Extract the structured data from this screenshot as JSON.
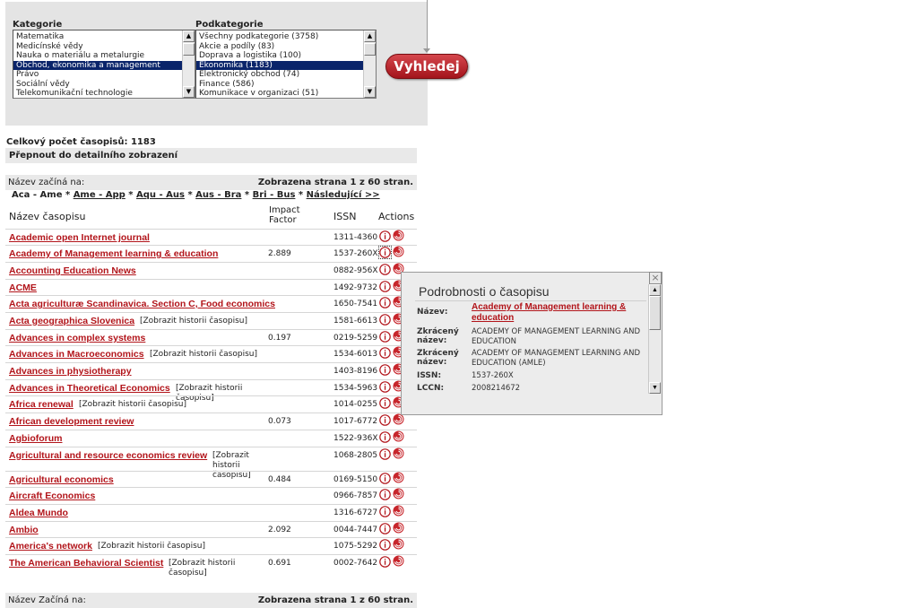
{
  "filters": {
    "category_label": "Kategorie",
    "category_options": [
      "Matematika",
      "Medicínské vědy",
      "Nauka o materiálu a metalurgie",
      "Obchod, ekonomika a management",
      "Právo",
      "Sociální vědy",
      "Telekomunikační technologie"
    ],
    "category_selected_index": 3,
    "subcategory_label": "Podkategorie",
    "subcategory_options": [
      "Všechny podkategorie (3758)",
      "Akcie a podíly (83)",
      "Doprava a logistika (100)",
      "Ekonomika (1183)",
      "Elektronický obchod (74)",
      "Finance (586)",
      "Komunikace v organizaci (51)"
    ],
    "subcategory_selected_index": 3,
    "search_label": "Vyhledej"
  },
  "summary": {
    "total_count": "Celkový počet časopisů: 1183",
    "toggle_view": "Přepnout do detailního zobrazení",
    "starts_with_label": "Název začíná na:",
    "starts_with_label_bottom": "Název Začíná na:",
    "page_info": "Zobrazena strana 1 z 60 stran."
  },
  "alpha_nav": {
    "current": "Aca - Ame",
    "links": [
      "Ame - App",
      "Aqu - Aus",
      "Aus - Bra",
      "Bri - Bus"
    ],
    "next": "Následující >>"
  },
  "table": {
    "headers": {
      "name": "Název časopisu",
      "impact_line1": "Impact",
      "impact_line2": "Factor",
      "issn": "ISSN",
      "actions": "Actions"
    },
    "rows": [
      {
        "name": "Academic open Internet journal",
        "history": "",
        "impact": "",
        "issn": "1311-4360"
      },
      {
        "name": "Academy of Management learning & education",
        "history": "",
        "impact": "2.889",
        "issn": "1537-260X"
      },
      {
        "name": "Accounting Education News",
        "history": "",
        "impact": "",
        "issn": "0882-956X"
      },
      {
        "name": "ACME",
        "history": "",
        "impact": "",
        "issn": "1492-9732"
      },
      {
        "name": "Acta agriculturæ Scandinavica. Section C, Food economics",
        "history": "",
        "impact": "",
        "issn": "1650-7541"
      },
      {
        "name": "Acta geographica Slovenica",
        "history": "[Zobrazit historii časopisu]",
        "impact": "",
        "issn": "1581-6613"
      },
      {
        "name": "Advances in complex systems",
        "history": "",
        "impact": "0.197",
        "issn": "0219-5259"
      },
      {
        "name": "Advances in Macroeconomics",
        "history": "[Zobrazit historii časopisu]",
        "impact": "",
        "issn": "1534-6013"
      },
      {
        "name": "Advances in physiotherapy",
        "history": "",
        "impact": "",
        "issn": "1403-8196"
      },
      {
        "name": "Advances in Theoretical Economics",
        "history": "[Zobrazit historii časopisu]",
        "impact": "",
        "issn": "1534-5963"
      },
      {
        "name": "Africa renewal",
        "history": "[Zobrazit historii časopisu]",
        "impact": "",
        "issn": "1014-0255"
      },
      {
        "name": "African development review",
        "history": "",
        "impact": "0.073",
        "issn": "1017-6772"
      },
      {
        "name": "Agbioforum",
        "history": "",
        "impact": "",
        "issn": "1522-936X"
      },
      {
        "name": "Agricultural and resource economics review",
        "history": "[Zobrazit historii časopisu]",
        "impact": "",
        "issn": "1068-2805"
      },
      {
        "name": "Agricultural economics",
        "history": "",
        "impact": "0.484",
        "issn": "0169-5150"
      },
      {
        "name": "Aircraft Economics",
        "history": "",
        "impact": "",
        "issn": "0966-7857"
      },
      {
        "name": "Aldea Mundo",
        "history": "",
        "impact": "",
        "issn": "1316-6727"
      },
      {
        "name": "Ambio",
        "history": "",
        "impact": "2.092",
        "issn": "0044-7447"
      },
      {
        "name": "America's network",
        "history": "[Zobrazit historii časopisu]",
        "impact": "",
        "issn": "1075-5292"
      },
      {
        "name": "The American Behavioral Scientist",
        "history": "[Zobrazit historii časopisu]",
        "impact": "0.691",
        "issn": "0002-7642"
      }
    ]
  },
  "popup": {
    "title": "Podrobnosti o časopisu",
    "close_glyph": "×",
    "fields": [
      {
        "label": "Název:",
        "value": "Academy of Management learning & education",
        "link": true
      },
      {
        "label": "Zkrácený název:",
        "value": "ACADEMY OF MANAGEMENT LEARNING AND EDUCATION",
        "link": false
      },
      {
        "label": "Zkrácený název:",
        "value": "ACADEMY OF MANAGEMENT LEARNING AND EDUCATION (AMLE)",
        "link": false
      },
      {
        "label": "ISSN:",
        "value": "1537-260X",
        "link": false
      },
      {
        "label": "LCCN:",
        "value": "2008214672",
        "link": false
      }
    ]
  },
  "icons": {
    "info": "info-icon",
    "history": "history-spiral-icon"
  },
  "colors": {
    "link_red": "#b2141a",
    "selected_blue": "#0a246a",
    "button_red": "#c02a30"
  }
}
